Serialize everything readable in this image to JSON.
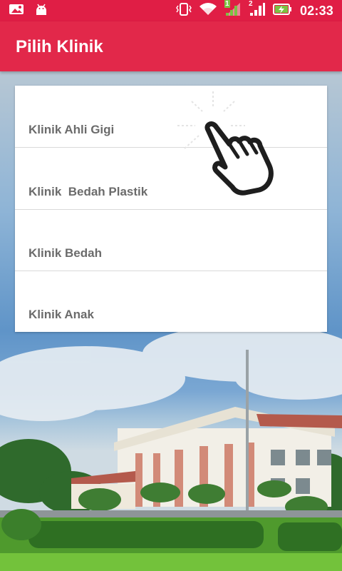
{
  "status_bar": {
    "time": "02:33",
    "icons": [
      "image-icon",
      "android-icon",
      "vibrate-icon",
      "wifi-icon",
      "signal-1-icon",
      "signal-2-icon",
      "battery-charging-icon"
    ],
    "sim1_label": "1",
    "sim2_label": "2"
  },
  "appbar": {
    "title": "Pilih Klinik"
  },
  "clinics": [
    {
      "label": "Klinik Ahli Gigi"
    },
    {
      "label": "Klinik  Bedah Plastik"
    },
    {
      "label": "Klinik Bedah"
    },
    {
      "label": "Klinik Anak"
    }
  ],
  "colors": {
    "primary": "#e2284a",
    "status_bar": "#e01e45",
    "item_text": "#6b6b6b"
  }
}
